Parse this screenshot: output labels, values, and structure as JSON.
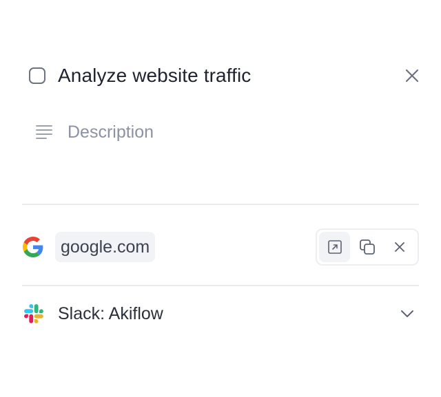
{
  "task": {
    "title": "Analyze website traffic",
    "description_placeholder": "Description"
  },
  "link": {
    "label": "google.com",
    "icon": "google-icon",
    "actions": [
      "open-external-icon",
      "copy-icon",
      "remove-icon"
    ]
  },
  "integration": {
    "label": "Slack: Akiflow",
    "icon": "slack-icon"
  },
  "icons": {
    "close": "close-icon",
    "description": "text-lines-icon",
    "expand": "chevron-down-icon"
  },
  "colors": {
    "text": "#1f2330",
    "muted": "#8b92a3",
    "chip_bg": "#f1f3f6",
    "divider": "#e9eaee"
  }
}
